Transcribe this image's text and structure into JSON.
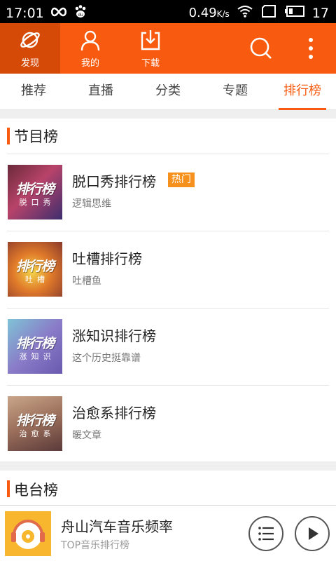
{
  "status_bar": {
    "time": "17:01",
    "data_speed": "0.49",
    "data_unit": "K/s",
    "battery": "17",
    "icons": [
      "infinity-icon",
      "baidu-paw-icon",
      "wifi-icon",
      "sim-icon",
      "battery-icon"
    ]
  },
  "header": {
    "nav": [
      {
        "label": "发现",
        "icon": "planet-icon",
        "active": true
      },
      {
        "label": "我的",
        "icon": "person-icon",
        "active": false
      },
      {
        "label": "下载",
        "icon": "download-icon",
        "active": false
      }
    ],
    "actions": [
      "search-icon",
      "more-vertical-icon"
    ]
  },
  "tabs": [
    {
      "label": "推荐",
      "active": false
    },
    {
      "label": "直播",
      "active": false
    },
    {
      "label": "分类",
      "active": false
    },
    {
      "label": "专题",
      "active": false
    },
    {
      "label": "排行榜",
      "active": true
    }
  ],
  "section_programs": {
    "title": "节目榜",
    "items": [
      {
        "title": "脱口秀排行榜",
        "badge": "热门",
        "subtitle": "逻辑思维",
        "thumb_title": "排行榜",
        "thumb_sub": "脱口秀"
      },
      {
        "title": "吐槽排行榜",
        "badge": "",
        "subtitle": "吐槽鱼",
        "thumb_title": "排行榜",
        "thumb_sub": "吐槽"
      },
      {
        "title": "涨知识排行榜",
        "badge": "",
        "subtitle": "这个历史挺靠谱",
        "thumb_title": "排行榜",
        "thumb_sub": "涨知识"
      },
      {
        "title": "治愈系排行榜",
        "badge": "",
        "subtitle": "暖文章",
        "thumb_title": "排行榜",
        "thumb_sub": "治愈系"
      }
    ]
  },
  "section_radio": {
    "title": "电台榜"
  },
  "player": {
    "title": "舟山汽车音乐频率",
    "subtitle": "TOP音乐排行榜",
    "buttons": [
      "playlist-icon",
      "play-icon"
    ]
  },
  "colors": {
    "accent": "#f85a0f",
    "header_active": "#d64a08",
    "badge": "#f6911e"
  }
}
